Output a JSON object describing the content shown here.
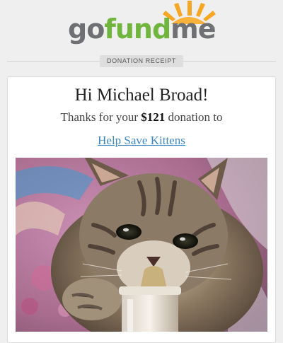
{
  "logo": {
    "go": "go",
    "fund": "fund",
    "me": "me",
    "tm": "™"
  },
  "header": {
    "badge": "DONATION RECEIPT"
  },
  "receipt": {
    "greeting": "Hi Michael Broad!",
    "thanks_prefix": "Thanks for your ",
    "amount": "$121",
    "thanks_suffix": " donation to",
    "campaign_title": "Help Save Kittens"
  },
  "colors": {
    "logo_gray": "#6f7073",
    "logo_green": "#6fb53e",
    "sun_orange": "#f5a623",
    "link_blue": "#3b87c4",
    "background": "#efefef"
  },
  "image": {
    "subject": "kitten drinking from bottle"
  }
}
